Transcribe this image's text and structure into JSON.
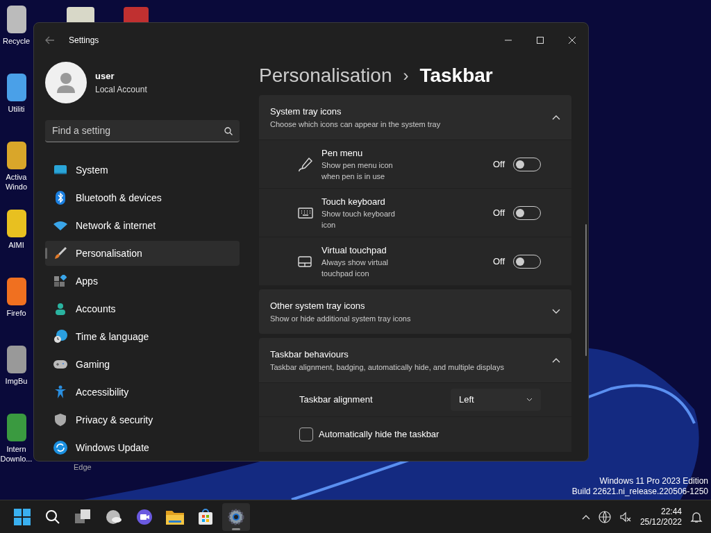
{
  "desktop_icons": [
    {
      "label": "Recycle"
    },
    {
      "label": "Utiliti"
    },
    {
      "label": "Activa\nWindo"
    },
    {
      "label": "AIMI"
    },
    {
      "label": "Firefo"
    },
    {
      "label": "ImgBu"
    },
    {
      "label": "Intern\nDownlo..."
    },
    {
      "label": "Edge"
    }
  ],
  "window": {
    "title": "Settings"
  },
  "account": {
    "name": "user",
    "type": "Local Account"
  },
  "search": {
    "placeholder": "Find a setting"
  },
  "sidebar": {
    "items": [
      {
        "label": "System",
        "selected": false
      },
      {
        "label": "Bluetooth & devices",
        "selected": false
      },
      {
        "label": "Network & internet",
        "selected": false
      },
      {
        "label": "Personalisation",
        "selected": true
      },
      {
        "label": "Apps",
        "selected": false
      },
      {
        "label": "Accounts",
        "selected": false
      },
      {
        "label": "Time & language",
        "selected": false
      },
      {
        "label": "Gaming",
        "selected": false
      },
      {
        "label": "Accessibility",
        "selected": false
      },
      {
        "label": "Privacy & security",
        "selected": false
      },
      {
        "label": "Windows Update",
        "selected": false
      }
    ]
  },
  "breadcrumb": {
    "parent": "Personalisation",
    "separator": "›",
    "current": "Taskbar"
  },
  "sections": [
    {
      "title": "System tray icons",
      "subtitle": "Choose which icons can appear in the system tray",
      "expanded": true,
      "rows": [
        {
          "kind": "toggle",
          "title": "Pen menu",
          "subtitle": "Show pen menu icon when pen is in use",
          "state_label": "Off",
          "on": false
        },
        {
          "kind": "toggle",
          "title": "Touch keyboard",
          "subtitle": "Show touch keyboard icon",
          "state_label": "Off",
          "on": false
        },
        {
          "kind": "toggle",
          "title": "Virtual touchpad",
          "subtitle": "Always show virtual touchpad icon",
          "state_label": "Off",
          "on": false
        }
      ]
    },
    {
      "title": "Other system tray icons",
      "subtitle": "Show or hide additional system tray icons",
      "expanded": false
    },
    {
      "title": "Taskbar behaviours",
      "subtitle": "Taskbar alignment, badging, automatically hide, and multiple displays",
      "expanded": true,
      "rows": [
        {
          "kind": "dropdown",
          "title": "Taskbar alignment",
          "value": "Left"
        },
        {
          "kind": "checkbox",
          "title": "Automatically hide the taskbar",
          "checked": false
        }
      ]
    }
  ],
  "watermark_text": [
    "Windows 11 Pro 2023 Edition",
    "Build 22621.ni_release.220506-1250"
  ],
  "taskbar": {
    "apps": [
      {
        "active": false
      },
      {
        "active": false
      },
      {
        "active": false
      },
      {
        "active": false
      },
      {
        "active": false
      },
      {
        "active": false
      },
      {
        "active": false
      },
      {
        "active": true
      }
    ],
    "time": "22:44",
    "date": "25/12/2022"
  }
}
